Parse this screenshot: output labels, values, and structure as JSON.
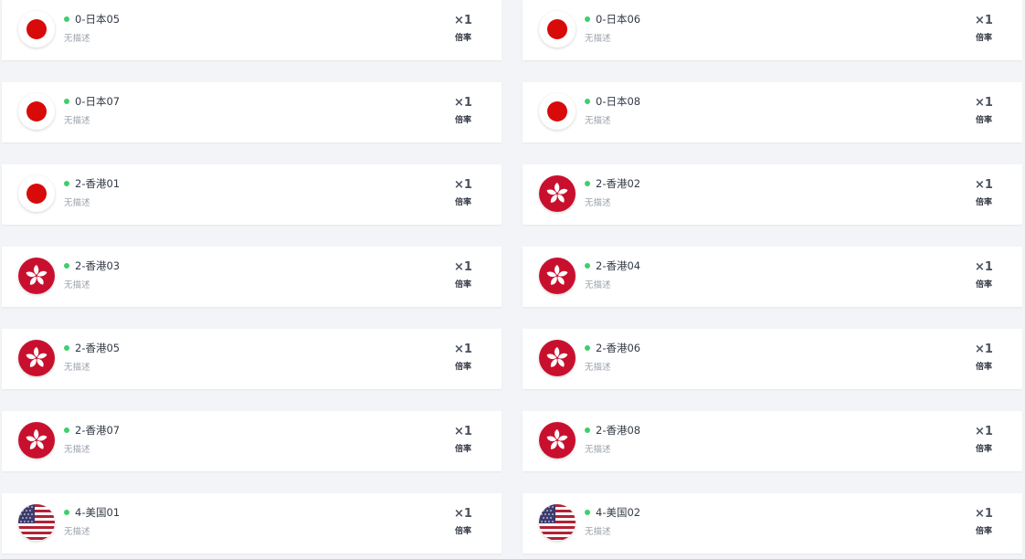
{
  "nodes": [
    {
      "name": "0-日本05",
      "desc": "无描述",
      "rate": "×1",
      "rate_label": "倍率",
      "flag": "japan-flag-icon"
    },
    {
      "name": "0-日本06",
      "desc": "无描述",
      "rate": "×1",
      "rate_label": "倍率",
      "flag": "japan-flag-icon"
    },
    {
      "name": "0-日本07",
      "desc": "无描述",
      "rate": "×1",
      "rate_label": "倍率",
      "flag": "japan-flag-icon"
    },
    {
      "name": "0-日本08",
      "desc": "无描述",
      "rate": "×1",
      "rate_label": "倍率",
      "flag": "japan-flag-icon"
    },
    {
      "name": "2-香港01",
      "desc": "无描述",
      "rate": "×1",
      "rate_label": "倍率",
      "flag": "japan-flag-icon"
    },
    {
      "name": "2-香港02",
      "desc": "无描述",
      "rate": "×1",
      "rate_label": "倍率",
      "flag": "hongkong-flag-icon"
    },
    {
      "name": "2-香港03",
      "desc": "无描述",
      "rate": "×1",
      "rate_label": "倍率",
      "flag": "hongkong-flag-icon"
    },
    {
      "name": "2-香港04",
      "desc": "无描述",
      "rate": "×1",
      "rate_label": "倍率",
      "flag": "hongkong-flag-icon"
    },
    {
      "name": "2-香港05",
      "desc": "无描述",
      "rate": "×1",
      "rate_label": "倍率",
      "flag": "hongkong-flag-icon"
    },
    {
      "name": "2-香港06",
      "desc": "无描述",
      "rate": "×1",
      "rate_label": "倍率",
      "flag": "hongkong-flag-icon"
    },
    {
      "name": "2-香港07",
      "desc": "无描述",
      "rate": "×1",
      "rate_label": "倍率",
      "flag": "hongkong-flag-icon"
    },
    {
      "name": "2-香港08",
      "desc": "无描述",
      "rate": "×1",
      "rate_label": "倍率",
      "flag": "hongkong-flag-icon"
    },
    {
      "name": "4-美国01",
      "desc": "无描述",
      "rate": "×1",
      "rate_label": "倍率",
      "flag": "usa-flag-icon"
    },
    {
      "name": "4-美国02",
      "desc": "无描述",
      "rate": "×1",
      "rate_label": "倍率",
      "flag": "usa-flag-icon"
    }
  ],
  "colors": {
    "status_online": "#3ecf6b",
    "japan_red": "#d80a0a",
    "hongkong_red": "#c8102e",
    "usa_red": "#b22234",
    "usa_blue": "#3c3b6e"
  }
}
